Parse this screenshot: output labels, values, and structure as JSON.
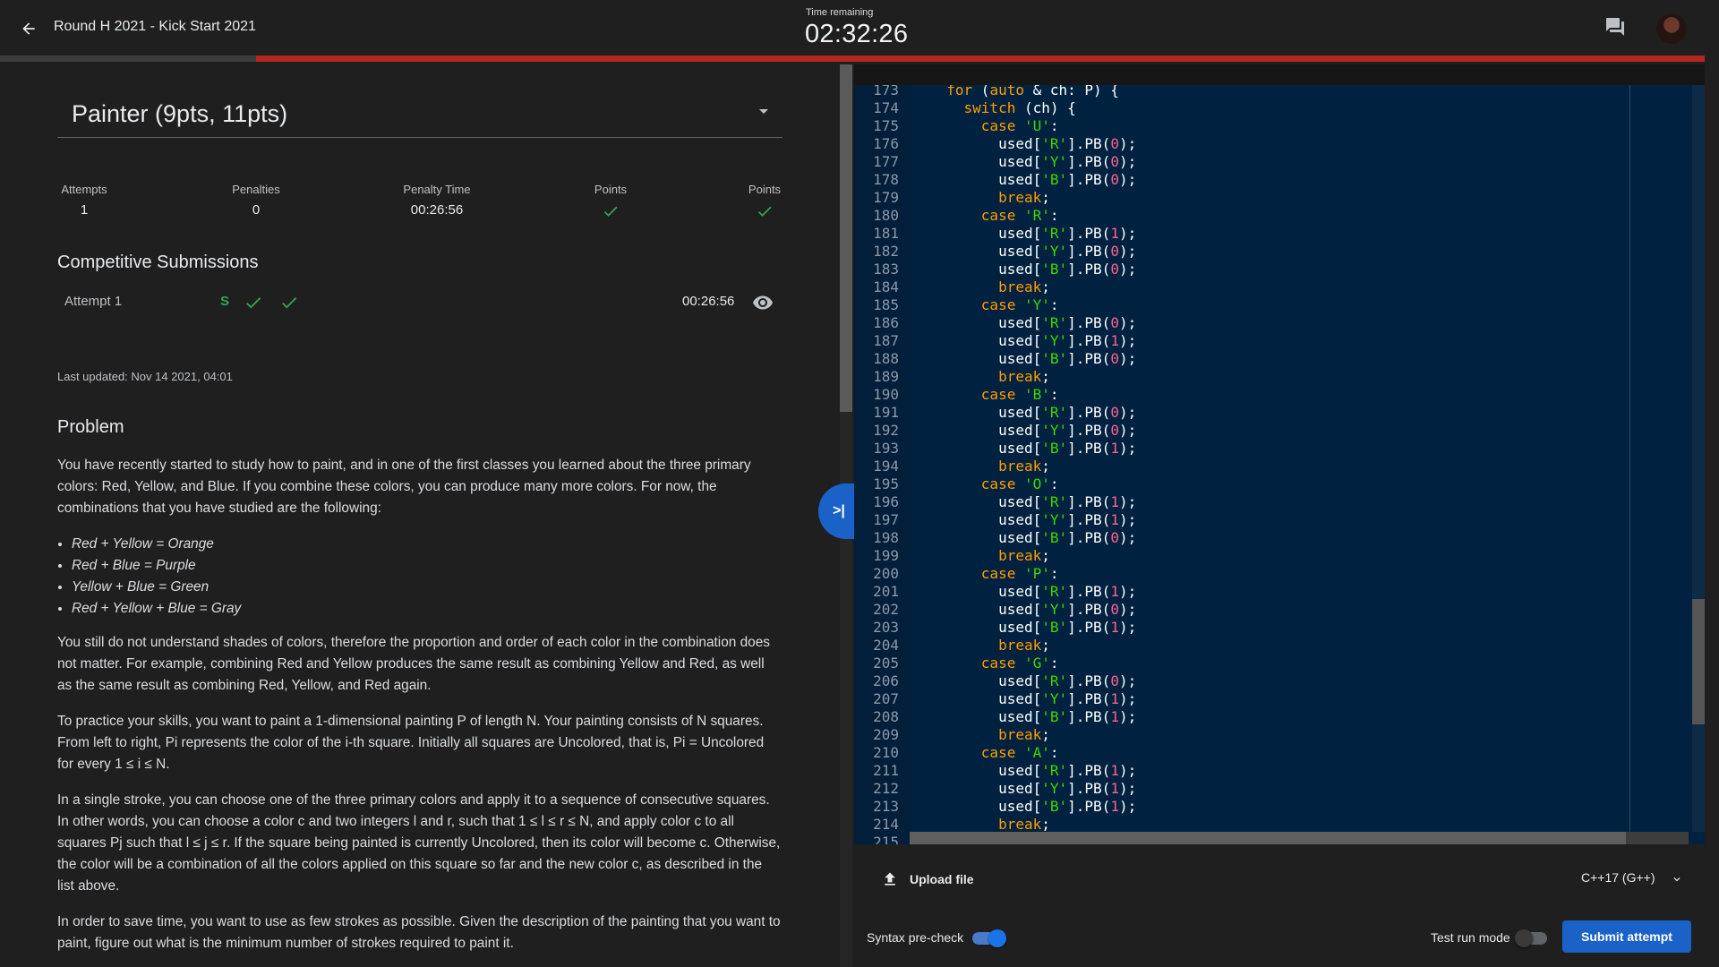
{
  "header": {
    "title": "Round H 2021 - Kick Start 2021",
    "timer_label": "Time remaining",
    "timer_value": "02:32:26",
    "timer_progress_fraction": 0.85
  },
  "problem_select": {
    "label": "Painter (9pts, 11pts)"
  },
  "stats": [
    {
      "label": "Attempts",
      "value": "1"
    },
    {
      "label": "Penalties",
      "value": "0"
    },
    {
      "label": "Penalty Time",
      "value": "00:26:56"
    },
    {
      "label": "Points",
      "value": "check"
    },
    {
      "label": "Points",
      "value": "check"
    }
  ],
  "submissions": {
    "heading": "Competitive Submissions",
    "attempts": [
      {
        "label": "Attempt 1",
        "status": "S",
        "results": [
          "check",
          "check"
        ],
        "time": "00:26:56"
      }
    ]
  },
  "last_updated": "Last updated: Nov 14 2021, 04:01",
  "problem": {
    "heading": "Problem",
    "p1": "You have recently started to study how to paint, and in one of the first classes you learned about the three primary colors: Red, Yellow, and Blue. If you combine these colors, you can produce many more colors. For now, the combinations that you have studied are the following:",
    "combos": [
      "Red + Yellow = Orange",
      "Red + Blue = Purple",
      "Yellow + Blue = Green",
      "Red + Yellow + Blue = Gray"
    ],
    "p2": "You still do not understand shades of colors, therefore the proportion and order of each color in the combination does not matter. For example, combining Red and Yellow produces the same result as combining Yellow and Red, as well as the same result as combining Red, Yellow, and Red again.",
    "p3": "To practice your skills, you want to paint a 1-dimensional painting P of length N. Your painting consists of N squares. From left to right, Pi represents the color of the i-th square. Initially all squares are Uncolored, that is, Pi = Uncolored for every 1 ≤ i ≤ N.",
    "p4": "In a single stroke, you can choose one of the three primary colors and apply it to a sequence of consecutive squares. In other words, you can choose a color c and two integers l and r, such that 1 ≤ l ≤ r ≤ N, and apply color c to all squares Pj such that l ≤ j ≤ r. If the square being painted is currently Uncolored, then its color will become c. Otherwise, the color will be a combination of all the colors applied on this square so far and the new color c, as described in the list above.",
    "p5": "In order to save time, you want to use as few strokes as possible. Given the description of the painting that you want to paint, figure out what is the minimum number of strokes required to paint it."
  },
  "editor": {
    "lines": [
      {
        "n": "173",
        "code": "  for (auto & ch: P) {"
      },
      {
        "n": "174",
        "code": "    switch (ch) {"
      },
      {
        "n": "175",
        "code": "      case 'U':"
      },
      {
        "n": "176",
        "code": "        used['R'].PB(0);"
      },
      {
        "n": "177",
        "code": "        used['Y'].PB(0);"
      },
      {
        "n": "178",
        "code": "        used['B'].PB(0);"
      },
      {
        "n": "179",
        "code": "        break;"
      },
      {
        "n": "180",
        "code": "      case 'R':"
      },
      {
        "n": "181",
        "code": "        used['R'].PB(1);"
      },
      {
        "n": "182",
        "code": "        used['Y'].PB(0);"
      },
      {
        "n": "183",
        "code": "        used['B'].PB(0);"
      },
      {
        "n": "184",
        "code": "        break;"
      },
      {
        "n": "185",
        "code": "      case 'Y':"
      },
      {
        "n": "186",
        "code": "        used['R'].PB(0);"
      },
      {
        "n": "187",
        "code": "        used['Y'].PB(1);"
      },
      {
        "n": "188",
        "code": "        used['B'].PB(0);"
      },
      {
        "n": "189",
        "code": "        break;"
      },
      {
        "n": "190",
        "code": "      case 'B':"
      },
      {
        "n": "191",
        "code": "        used['R'].PB(0);"
      },
      {
        "n": "192",
        "code": "        used['Y'].PB(0);"
      },
      {
        "n": "193",
        "code": "        used['B'].PB(1);"
      },
      {
        "n": "194",
        "code": "        break;"
      },
      {
        "n": "195",
        "code": "      case 'O':"
      },
      {
        "n": "196",
        "code": "        used['R'].PB(1);"
      },
      {
        "n": "197",
        "code": "        used['Y'].PB(1);"
      },
      {
        "n": "198",
        "code": "        used['B'].PB(0);"
      },
      {
        "n": "199",
        "code": "        break;"
      },
      {
        "n": "200",
        "code": "      case 'P':"
      },
      {
        "n": "201",
        "code": "        used['R'].PB(1);"
      },
      {
        "n": "202",
        "code": "        used['Y'].PB(0);"
      },
      {
        "n": "203",
        "code": "        used['B'].PB(1);"
      },
      {
        "n": "204",
        "code": "        break;"
      },
      {
        "n": "205",
        "code": "      case 'G':"
      },
      {
        "n": "206",
        "code": "        used['R'].PB(0);"
      },
      {
        "n": "207",
        "code": "        used['Y'].PB(1);"
      },
      {
        "n": "208",
        "code": "        used['B'].PB(1);"
      },
      {
        "n": "209",
        "code": "        break;"
      },
      {
        "n": "210",
        "code": "      case 'A':"
      },
      {
        "n": "211",
        "code": "        used['R'].PB(1);"
      },
      {
        "n": "212",
        "code": "        used['Y'].PB(1);"
      },
      {
        "n": "213",
        "code": "        used['B'].PB(1);"
      },
      {
        "n": "214",
        "code": "        break;"
      },
      {
        "n": "215",
        "code": "    }"
      }
    ]
  },
  "footer": {
    "upload_label": "Upload file",
    "language": "C++17 (G++)",
    "syntax_label": "Syntax pre-check",
    "syntax_on": true,
    "test_label": "Test run mode",
    "test_on": false,
    "submit_label": "Submit attempt"
  },
  "colors": {
    "accent": "#1a62c7",
    "progress": "#b3261e",
    "success": "#34a853",
    "editor_bg": "#002240"
  },
  "icons": {
    "back": "arrow-left-icon",
    "chat": "chat-bubbles-icon",
    "view": "eye-icon",
    "collapse": "collapse-panel-icon",
    "upload": "upload-icon",
    "lang_caret": "chevron-down-icon",
    "check": "check-icon"
  }
}
